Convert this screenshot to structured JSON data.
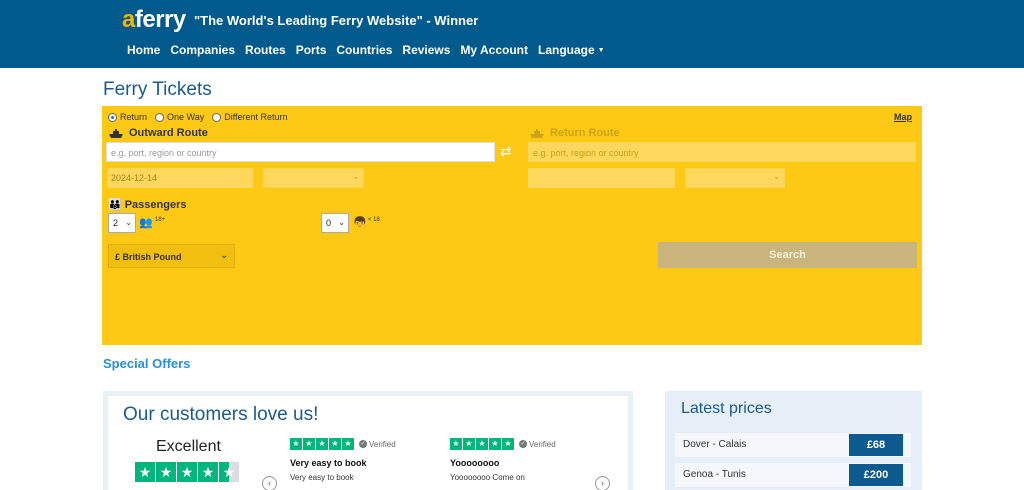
{
  "header": {
    "logo": {
      "prefix": "a",
      "rest": "ferry"
    },
    "tagline": "\"The World's Leading Ferry Website\" - Winner",
    "nav": [
      "Home",
      "Companies",
      "Routes",
      "Ports",
      "Countries",
      "Reviews",
      "My Account",
      "Language"
    ]
  },
  "page_title": "Ferry Tickets",
  "booking": {
    "trip_types": [
      "Return",
      "One Way",
      "Different Return"
    ],
    "selected_trip_type": "Return",
    "map_link": "Map",
    "outward_label": "Outward Route",
    "return_label": "Return Route",
    "outward_placeholder": "e.g. port, region or country",
    "return_placeholder": "e.g. port, region or country",
    "outward_date": "2024-12-14",
    "passengers_label": "Passengers",
    "adults_value": "2",
    "adults_note": "18+",
    "children_value": "0",
    "children_note": "< 18",
    "currency": "£ British Pound",
    "search_label": "Search"
  },
  "special_offers": "Special Offers",
  "reviews": {
    "title": "Our customers love us!",
    "rating_word": "Excellent",
    "verified_label": "Verified",
    "items": [
      {
        "title": "Very easy to book",
        "body": "Very easy to book"
      },
      {
        "title": "Yoooooooo",
        "body": "Yoooooooo Come on"
      }
    ]
  },
  "latest_prices": {
    "title": "Latest prices",
    "rows": [
      {
        "route": "Dover - Calais",
        "price": "£68"
      },
      {
        "route": "Genoa - Tunis",
        "price": "£200"
      }
    ]
  },
  "colors": {
    "header_bg": "#005a8c",
    "booking_bg": "#fdc914",
    "accent_blue": "#2a8fd8",
    "trustpilot_green": "#00b67a"
  }
}
